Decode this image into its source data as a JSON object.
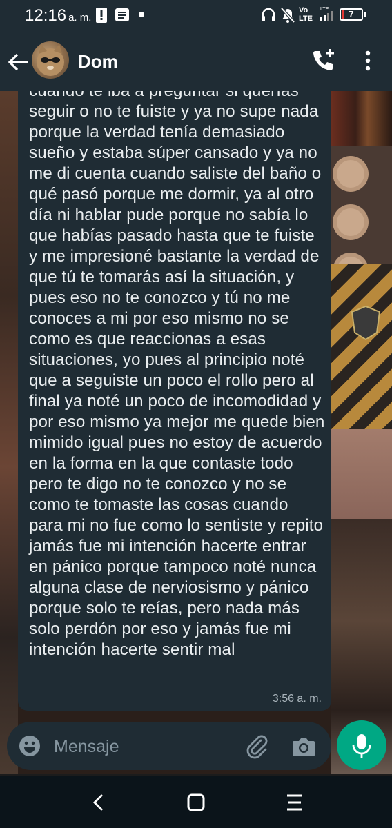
{
  "status_bar": {
    "time": "12:16",
    "ampm": "a. m.",
    "network": "Vo LTE",
    "battery_level": "7"
  },
  "header": {
    "contact_name": "Dom"
  },
  "message": {
    "text": "cuando te iba a preguntar si querías seguir o no te fuiste y ya no supe nada porque la verdad tenía demasiado sueño y estaba súper cansado y ya no me di cuenta cuando saliste del baño o qué pasó porque me dormir, ya al otro día ni hablar pude porque no sabía lo que habías pasado hasta que te fuiste y me impresioné bastante la verdad de que tú te tomarás así la situación, y pues eso no te conozco y tú no me conoces a mi por eso mismo no se como es que reaccionas a esas situaciones, yo pues al principio noté que a seguiste un poco el rollo pero al final ya noté un poco de incomodidad y por eso mismo ya mejor me quede bien mimido igual pues no estoy de acuerdo en la forma en la que contaste todo pero te digo no te conozco y no se como te tomaste las cosas cuando para mi no fue como lo sentiste y repito jamás fue mi intención hacerte entrar en pánico porque tampoco noté nunca alguna clase de nerviosismo y pánico porque solo te reías, pero nada más solo perdón por eso y jamás fue mi intención hacerte sentir mal",
    "time": "3:56 a. m."
  },
  "composer": {
    "placeholder": "Mensaje"
  },
  "colors": {
    "header_bg": "#1f2c34",
    "bubble_bg": "#1f2c34",
    "accent": "#00a884",
    "nav_bg": "#0b141a",
    "text": "#e9edef",
    "muted": "#8696a0",
    "battery_low": "#e53935"
  },
  "icons": {
    "back": "arrow-left-icon",
    "call": "add-call-icon",
    "menu": "more-vert-icon",
    "emoji": "emoji-icon",
    "attach": "paperclip-icon",
    "camera": "camera-icon",
    "mic": "microphone-icon"
  }
}
